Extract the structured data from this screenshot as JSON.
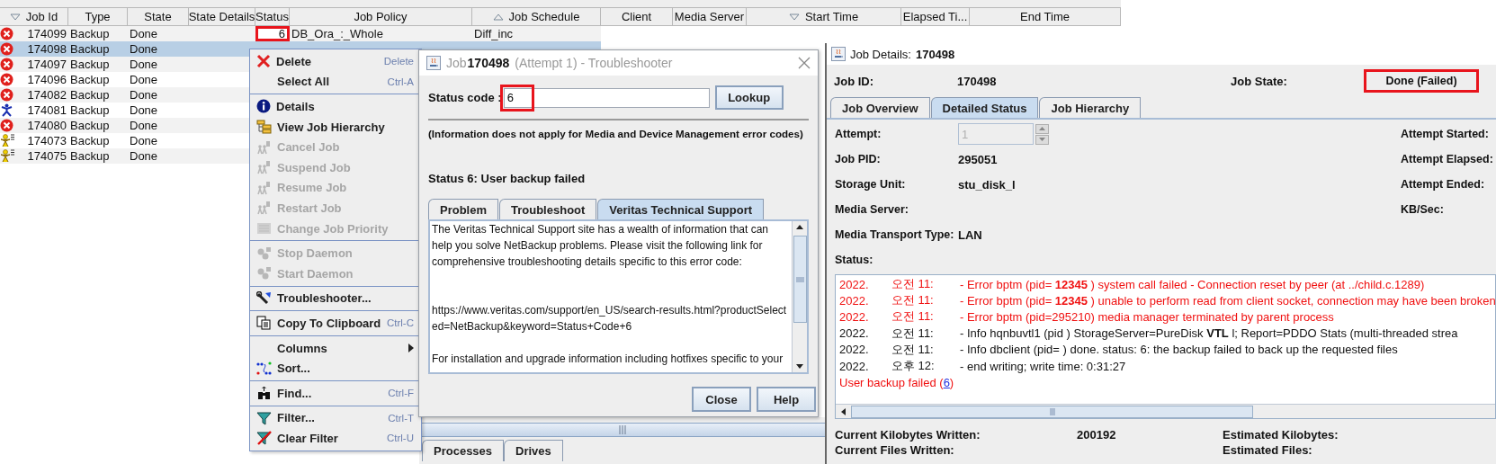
{
  "job_table": {
    "columns": [
      {
        "label": "Job Id",
        "kind": "sort-desc"
      },
      {
        "label": "Type"
      },
      {
        "label": "State"
      },
      {
        "label": "State Details"
      },
      {
        "label": "Status"
      },
      {
        "label": "Job Policy"
      },
      {
        "label": "Job Schedule",
        "kind": "sort-asc"
      },
      {
        "label": "Client"
      },
      {
        "label": "Media Server"
      },
      {
        "label": "Start Time",
        "kind": "sort-desc"
      },
      {
        "label": "Elapsed Ti..."
      },
      {
        "label": "End Time"
      }
    ],
    "rows": [
      {
        "kind": "error",
        "job_id": "174099",
        "type": "Backup",
        "state": "Done",
        "status": "6",
        "status_highlighted": true,
        "job_policy": "DB_Ora_:_Whole",
        "job_schedule": "Diff_inc",
        "selected": false
      },
      {
        "kind": "error",
        "job_id": "174098",
        "type": "Backup",
        "state": "Done",
        "selected": true
      },
      {
        "kind": "error",
        "job_id": "174097",
        "type": "Backup",
        "state": "Done",
        "selected": false
      },
      {
        "kind": "error",
        "job_id": "174096",
        "type": "Backup",
        "state": "Done",
        "selected": false
      },
      {
        "kind": "error",
        "job_id": "174082",
        "type": "Backup",
        "state": "Done",
        "selected": false
      },
      {
        "kind": "running",
        "job_id": "174081",
        "type": "Backup",
        "state": "Done",
        "selected": false
      },
      {
        "kind": "error",
        "job_id": "174080",
        "type": "Backup",
        "state": "Done",
        "selected": false
      },
      {
        "kind": "queued",
        "job_id": "174073",
        "type": "Backup",
        "state": "Done",
        "selected": false
      },
      {
        "kind": "queued",
        "job_id": "174075",
        "type": "Backup",
        "state": "Done",
        "selected": false
      }
    ]
  },
  "context_menu": {
    "groups": [
      [
        {
          "kind": "delete",
          "label": "Delete",
          "shortcut": "Delete",
          "disabled": false
        },
        {
          "kind": "none",
          "label": "Select All",
          "shortcut": "Ctrl-A",
          "disabled": false
        }
      ],
      [
        {
          "kind": "info",
          "label": "Details",
          "disabled": false
        },
        {
          "kind": "hierarchy",
          "label": "View Job Hierarchy",
          "disabled": false
        },
        {
          "kind": "figures",
          "label": "Cancel Job",
          "disabled": true
        },
        {
          "kind": "figures",
          "label": "Suspend Job",
          "disabled": true
        },
        {
          "kind": "figures",
          "label": "Resume Job",
          "disabled": true
        },
        {
          "kind": "figures",
          "label": "Restart Job",
          "disabled": true
        },
        {
          "kind": "priority",
          "label": "Change Job Priority",
          "disabled": true
        }
      ],
      [
        {
          "kind": "gears",
          "label": "Stop Daemon",
          "disabled": true
        },
        {
          "kind": "gears",
          "label": "Start Daemon",
          "disabled": true
        }
      ],
      [
        {
          "kind": "tools",
          "label": "Troubleshooter...",
          "disabled": false
        }
      ],
      [
        {
          "kind": "copy",
          "label": "Copy To Clipboard",
          "shortcut": "Ctrl-C",
          "disabled": false
        }
      ],
      [
        {
          "kind": "none",
          "label": "Columns",
          "submenu": true,
          "disabled": false
        },
        {
          "kind": "sort",
          "label": "Sort...",
          "disabled": false
        }
      ],
      [
        {
          "kind": "find",
          "label": "Find...",
          "shortcut": "Ctrl-F",
          "disabled": false
        }
      ],
      [
        {
          "kind": "filter",
          "label": "Filter...",
          "shortcut": "Ctrl-T",
          "disabled": false
        },
        {
          "kind": "clear-filter",
          "label": "Clear Filter",
          "shortcut": "Ctrl-U",
          "disabled": false
        }
      ]
    ]
  },
  "troubleshooter": {
    "title_prefix": "Job",
    "title_job_id": "170498",
    "title_suffix": "(Attempt 1) - Troubleshooter",
    "status_code_label": "Status code :",
    "status_code_value": "6",
    "status_code_highlighted": true,
    "lookup_button": "Lookup",
    "note": "(Information does not apply for Media and Device Management error codes)",
    "status_heading": "Status 6: User backup failed",
    "tabs": [
      {
        "label": "Problem",
        "selected": false
      },
      {
        "label": "Troubleshoot",
        "selected": false
      },
      {
        "label": "Veritas Technical Support",
        "selected": true
      }
    ],
    "intro": "The Veritas Technical Support site has a wealth of information that can help you solve NetBackup problems. Please visit the following link for comprehensive troubleshooting details specific to this error code:",
    "link": "https://www.veritas.com/support/en_US/search-results.html?productSelected=NetBackup&keyword=Status+Code+6",
    "outro": "For installation and upgrade information including hotfixes specific to your",
    "buttons": [
      "Close",
      "Help"
    ]
  },
  "bottom_tabs": [
    {
      "label": "Processes",
      "selected": false
    },
    {
      "label": "Drives",
      "selected": false
    }
  ],
  "job_details": {
    "title_label": "Job Details:",
    "title_job_id": "170498",
    "job_id_label": "Job ID:",
    "job_id": "170498",
    "job_state_label": "Job State:",
    "job_state": "Done (Failed)",
    "job_state_highlighted": true,
    "tabs": [
      {
        "label": "Job Overview",
        "selected": false
      },
      {
        "label": "Detailed Status",
        "selected": true
      },
      {
        "label": "Job Hierarchy",
        "selected": false
      }
    ],
    "attempt_label": "Attempt:",
    "attempt_value": "1",
    "attempt_disabled": true,
    "fields": [
      {
        "label": "Job PID:",
        "value": "295051"
      },
      {
        "label": "Storage Unit:",
        "value": "stu_disk_l"
      },
      {
        "label": "Media Server:"
      },
      {
        "label": "Media Transport Type:",
        "value": "LAN"
      }
    ],
    "right_labels": [
      "Attempt Started:",
      "Attempt Elapsed:",
      "Attempt Ended:",
      "KB/Sec:"
    ],
    "status_label": "Status:",
    "log": [
      {
        "date": "2022.",
        "time": "오전 11:",
        "message": "- Error bptm (pid= **12345** ) system call failed - Connection reset by peer (at ../child.c.1289)",
        "kind": "error"
      },
      {
        "date": "2022.",
        "time": "오전 11:",
        "message": "- Error bptm (pid= **12345** ) unable to perform read from client socket, connection may have been broken",
        "kind": "error"
      },
      {
        "date": "2022.",
        "time": "오전 11:",
        "message": "- Error bptm (pid=295210) media manager terminated by parent process",
        "kind": "error"
      },
      {
        "date": "2022.",
        "time": "오전 11:",
        "message": "- Info hqnbuvtl1 (pid ) StorageServer=PureDisk **VTL** l; Report=PDDO Stats (multi-threaded strea",
        "kind": "info"
      },
      {
        "date": "2022.",
        "time": "오전 11:",
        "message": "- Info dbclient (pid= ) done. status: 6: the backup failed to back up the requested files",
        "kind": "info"
      },
      {
        "date": "2022.",
        "time": "오후 12:",
        "message": "- end writing; write time: 0:31:27",
        "kind": "info"
      }
    ],
    "result": {
      "prefix": "User backup failed  (",
      "link": "6",
      "suffix": ")"
    },
    "footer": [
      {
        "label": "Current Kilobytes Written:",
        "value": "200192",
        "right_label": "Estimated Kilobytes:"
      },
      {
        "label": "Current Files Written:",
        "right_label": "Estimated Files:"
      }
    ]
  }
}
